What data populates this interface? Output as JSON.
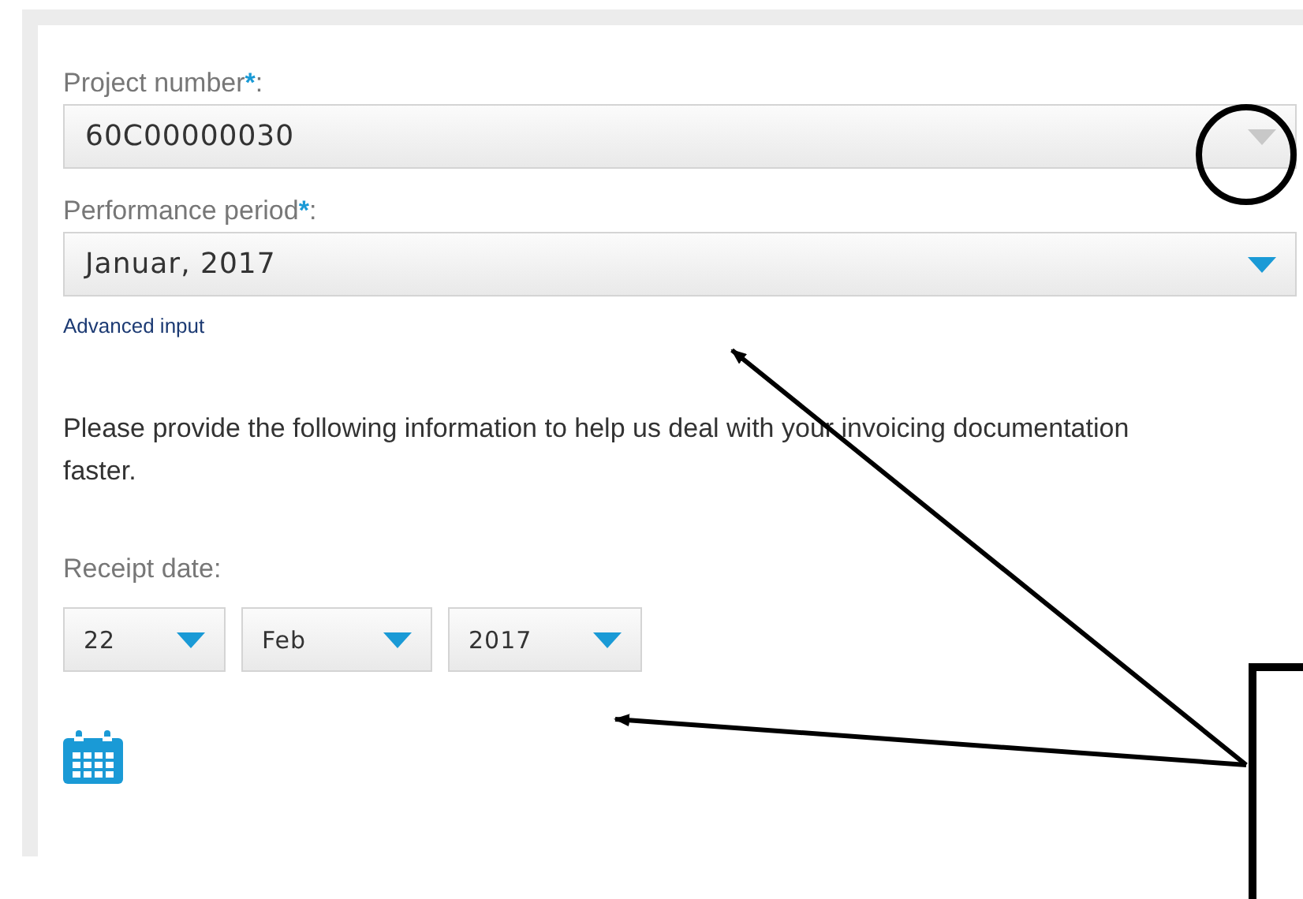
{
  "fields": [
    {
      "kind": "select",
      "label": "Project number",
      "required_mark": "*",
      "label_end": ":",
      "value": "60C00000030",
      "disabled": true
    },
    {
      "kind": "select",
      "label": "Performance period",
      "required_mark": "*",
      "label_end": ":",
      "value": "Januar, 2017",
      "disabled": false
    }
  ],
  "advanced_link": "Advanced input",
  "info_text": "Please provide the following information to help us deal with your invoicing documentation faster.",
  "receipt_date": {
    "label": "Receipt date:",
    "parts": [
      {
        "value": "22"
      },
      {
        "value": "Feb"
      },
      {
        "value": "2017"
      }
    ]
  }
}
